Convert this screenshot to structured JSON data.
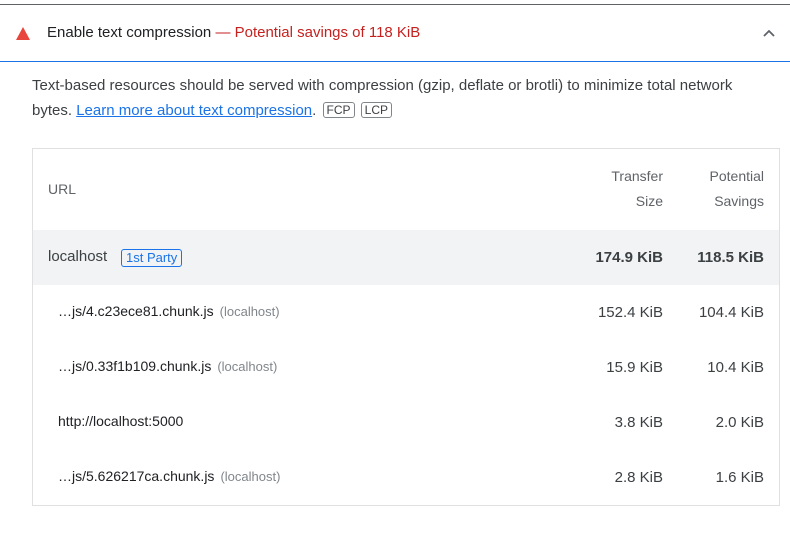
{
  "audit": {
    "title": "Enable text compression",
    "savings": "— Potential savings of 118 KiB",
    "icons": {
      "status": "warning-triangle-icon",
      "toggle": "chevron-up-icon"
    },
    "colors": {
      "warning": "#e8453c",
      "savings_text": "#c5221f",
      "link": "#1a73e8"
    }
  },
  "description": {
    "text": "Text-based resources should be served with compression (gzip, deflate or brotli) to minimize total network bytes. ",
    "link_text": "Learn more about text compression",
    "after_link": ".",
    "tags": [
      "FCP",
      "LCP"
    ]
  },
  "table": {
    "headers": {
      "url": "URL",
      "transfer_line1": "Transfer",
      "transfer_line2": "Size",
      "savings_line1": "Potential",
      "savings_line2": "Savings"
    },
    "group": {
      "name": "localhost",
      "badge": "1st Party",
      "transfer": "174.9 KiB",
      "savings": "118.5 KiB"
    },
    "rows": [
      {
        "url": "…js/4.c23ece81.chunk.js",
        "host": "(localhost)",
        "transfer": "152.4 KiB",
        "savings": "104.4 KiB"
      },
      {
        "url": "…js/0.33f1b109.chunk.js",
        "host": "(localhost)",
        "transfer": "15.9 KiB",
        "savings": "10.4 KiB"
      },
      {
        "url": "http://localhost:5000",
        "host": "",
        "transfer": "3.8 KiB",
        "savings": "2.0 KiB"
      },
      {
        "url": "…js/5.626217ca.chunk.js",
        "host": "(localhost)",
        "transfer": "2.8 KiB",
        "savings": "1.6 KiB"
      }
    ]
  }
}
